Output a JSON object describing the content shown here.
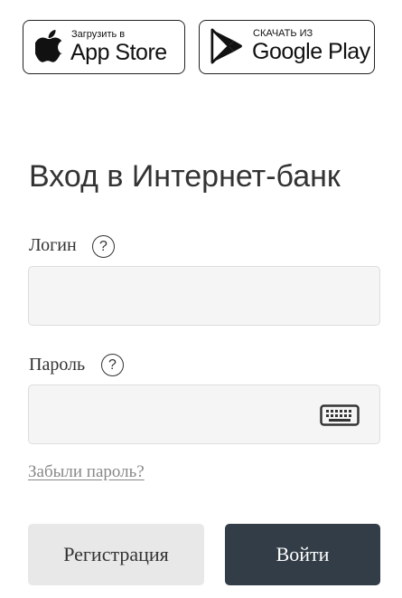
{
  "app_badges": {
    "appstore": {
      "small_text": "Загрузить в",
      "big_text": "App Store",
      "icon": "apple-icon"
    },
    "googleplay": {
      "small_text": "СКАЧАТЬ ИЗ",
      "big_text": "Google Play",
      "icon": "google-play-icon"
    }
  },
  "page": {
    "title": "Вход в Интернет-банк"
  },
  "login": {
    "label": "Логин",
    "help": "?",
    "value": "",
    "placeholder": ""
  },
  "password": {
    "label": "Пароль",
    "help": "?",
    "value": "",
    "placeholder": "",
    "keyboard_icon": "keyboard-icon"
  },
  "links": {
    "forgot_password": "Забыли пароль?"
  },
  "buttons": {
    "register": "Регистрация",
    "login": "Войти"
  },
  "colors": {
    "primary_button": "#323d47",
    "secondary_button": "#e8e8e8",
    "input_bg": "#f5f5f5",
    "link": "#888888"
  }
}
